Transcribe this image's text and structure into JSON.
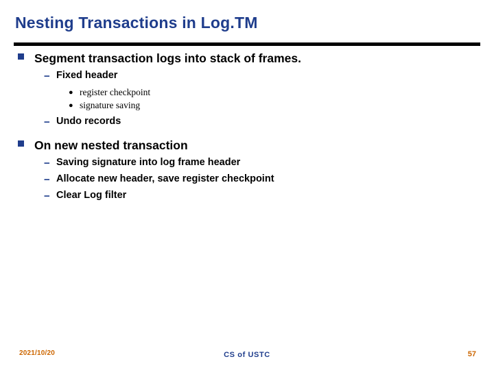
{
  "slide": {
    "title": "Nesting Transactions in Log.TM",
    "blocks": [
      {
        "level": 1,
        "marker": "square",
        "text": "Segment transaction logs into stack of frames."
      },
      {
        "level": 2,
        "marker": "−",
        "text": "Fixed header"
      },
      {
        "level": 3,
        "marker": "●",
        "text": "register checkpoint"
      },
      {
        "level": 3,
        "marker": "●",
        "text": "signature saving"
      },
      {
        "level": 2,
        "marker": "−",
        "text": "Undo records"
      },
      {
        "level": 1,
        "marker": "square",
        "text": "On new nested transaction"
      },
      {
        "level": 2,
        "marker": "−",
        "text": "Saving signature into log frame header"
      },
      {
        "level": 2,
        "marker": "−",
        "text": "Allocate new header, save register checkpoint"
      },
      {
        "level": 2,
        "marker": "−",
        "text": "Clear Log filter"
      }
    ],
    "footer": {
      "date": "2021/10/20",
      "center": "CS of USTC",
      "page": "57"
    },
    "colors": {
      "title": "#1f3D8C",
      "bullet": "#1f3D8C",
      "footer_accent": "#CC6600",
      "rule": "#000000"
    }
  }
}
